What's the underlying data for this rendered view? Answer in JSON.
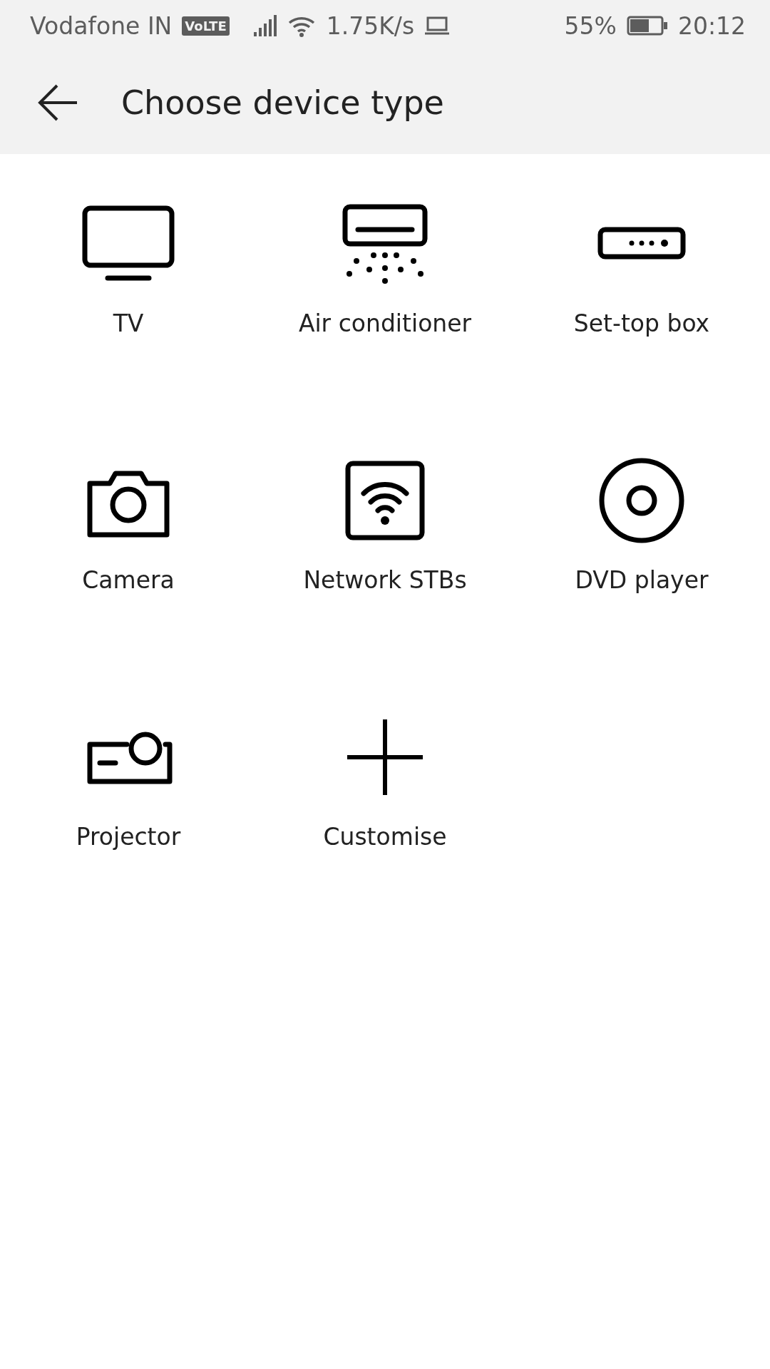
{
  "status_bar": {
    "carrier": "Vodafone IN",
    "network_badge": "VoLTE",
    "speed": "1.75K/s",
    "battery_percent": "55%",
    "time": "20:12"
  },
  "header": {
    "title": "Choose device type"
  },
  "devices": [
    {
      "kind": "tv",
      "label": "TV"
    },
    {
      "kind": "ac",
      "label": "Air conditioner"
    },
    {
      "kind": "stb",
      "label": "Set-top box"
    },
    {
      "kind": "camera",
      "label": "Camera"
    },
    {
      "kind": "network",
      "label": "Network STBs"
    },
    {
      "kind": "dvd",
      "label": "DVD player"
    },
    {
      "kind": "projector",
      "label": "Projector"
    },
    {
      "kind": "custom",
      "label": "Customise"
    }
  ]
}
